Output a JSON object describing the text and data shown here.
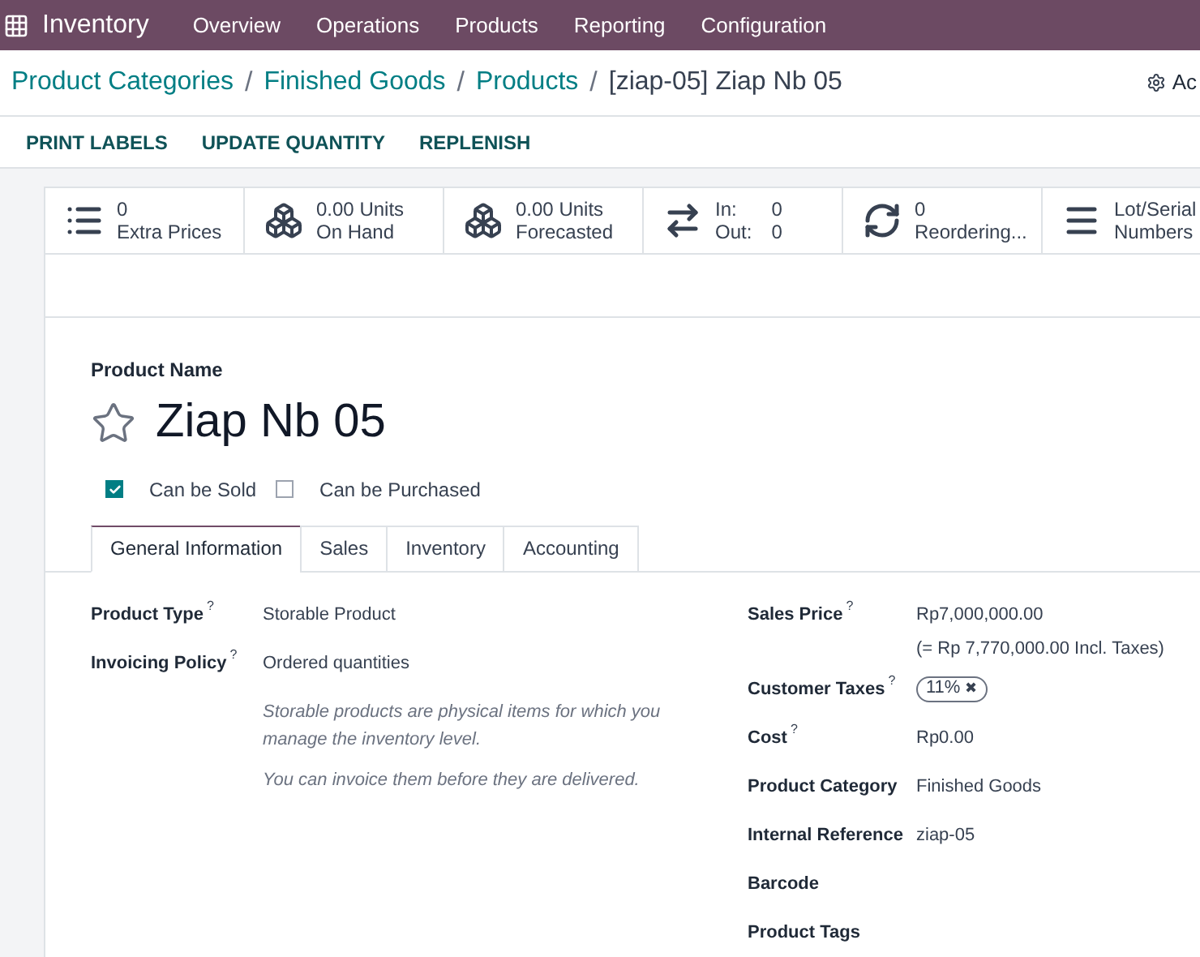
{
  "navbar": {
    "app": "Inventory",
    "menu": [
      "Overview",
      "Operations",
      "Products",
      "Reporting",
      "Configuration"
    ]
  },
  "breadcrumbs": [
    {
      "label": "Product Categories",
      "kind": "link"
    },
    {
      "label": "Finished Goods",
      "kind": "link"
    },
    {
      "label": "Products",
      "kind": "link"
    },
    {
      "label": "[ziap-05] Ziap Nb 05",
      "kind": "current"
    }
  ],
  "breadcrumb_separator": "/",
  "action_menu": "Ac",
  "actions": [
    "PRINT LABELS",
    "UPDATE QUANTITY",
    "REPLENISH"
  ],
  "stat_buttons": [
    {
      "kind": "list",
      "value": "0",
      "label": "Extra Prices"
    },
    {
      "kind": "cubes",
      "value": "0.00 Units",
      "label": "On Hand"
    },
    {
      "kind": "cubes",
      "value": "0.00 Units",
      "label": "Forecasted"
    },
    {
      "kind": "inout",
      "in_label": "In:",
      "in_value": "0",
      "out_label": "Out:",
      "out_value": "0"
    },
    {
      "kind": "refresh",
      "value": "0",
      "label": "Reordering..."
    },
    {
      "kind": "bars",
      "value": "Lot/Serial",
      "label": "Numbers"
    }
  ],
  "product_name_label": "Product Name",
  "product_name": "Ziap Nb 05",
  "favorite": false,
  "options": [
    {
      "label": "Can be Sold",
      "checked": true
    },
    {
      "label": "Can be Purchased",
      "checked": false
    }
  ],
  "tabs": [
    {
      "label": "General Information",
      "selected": true
    },
    {
      "label": "Sales",
      "selected": false
    },
    {
      "label": "Inventory",
      "selected": false
    },
    {
      "label": "Accounting",
      "selected": false
    }
  ],
  "left_fields": [
    {
      "label": "Product Type",
      "hint": "?",
      "value": "Storable Product"
    },
    {
      "label": "Invoicing Policy",
      "hint": "?",
      "value": "Ordered quantities"
    }
  ],
  "notes": [
    "Storable products are physical items for which you manage the inventory level.",
    "You can invoice them before they are delivered."
  ],
  "right_fields": [
    {
      "label": "Sales Price",
      "hint": "?",
      "kind": "price",
      "value": "Rp7,000,000.00",
      "sub": "(= Rp 7,770,000.00 Incl. Taxes)"
    },
    {
      "label": "Customer Taxes",
      "hint": "?",
      "kind": "tags",
      "tags": [
        {
          "label": "11%",
          "remove": "✖"
        }
      ]
    },
    {
      "label": "Cost",
      "hint": "?",
      "kind": "text",
      "value": "Rp0.00"
    },
    {
      "label": "Product Category",
      "kind": "text",
      "value": "Finished Goods"
    },
    {
      "label": "Internal Reference",
      "kind": "text",
      "value": "ziap-05"
    },
    {
      "label": "Barcode",
      "kind": "text"
    },
    {
      "label": "Product Tags",
      "kind": "text"
    }
  ]
}
